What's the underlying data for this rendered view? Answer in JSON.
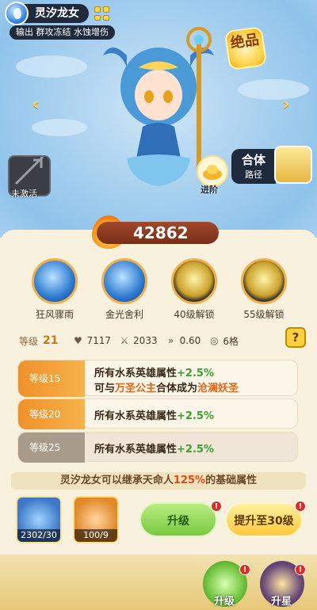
{
  "hero": {
    "name": "灵汐龙女",
    "tags": "输出 群攻冻结 水蚀增伤",
    "rarity": "绝品",
    "weapon_status": "未激活",
    "advance_label": "进阶",
    "merge_title": "合体",
    "merge_sub": "路径"
  },
  "power": "42862",
  "skills": [
    {
      "label": "狂风骤雨",
      "locked": false
    },
    {
      "label": "金光舍利",
      "locked": false
    },
    {
      "label": "40级解锁",
      "locked": true
    },
    {
      "label": "55级解锁",
      "locked": true
    }
  ],
  "stats": {
    "level_label": "等级",
    "level_value": "21",
    "hp": "7117",
    "atk": "2033",
    "speed": "0.60",
    "cells": "6格",
    "help": "?"
  },
  "level_rows": [
    {
      "tag": "等级15",
      "line1_a": "所有水系英雄属性",
      "line1_b": "+2.5%",
      "line2_a": "可与",
      "line2_b": "万圣公主",
      "line2_c": "合体成为",
      "line2_d": "沧澜妖圣",
      "active": true
    },
    {
      "tag": "等级20",
      "line1_a": "所有水系英雄属性",
      "line1_b": "+2.5%",
      "active": true
    },
    {
      "tag": "等级25",
      "line1_a": "所有水系英雄属性",
      "line1_b": "+2.5%",
      "active": false
    }
  ],
  "inherit": {
    "prefix": "灵汐龙女可以继承天命人",
    "pct": "125%",
    "suffix": "的基础属性"
  },
  "materials": [
    {
      "count": "2302/30",
      "color": "#3e78c8"
    },
    {
      "count": "100/9",
      "color": "#e08a2a"
    }
  ],
  "buttons": {
    "upgrade": "升级",
    "promote": "提升至30级",
    "badge": "!"
  },
  "nav": {
    "upgrade": "升级",
    "star": "升星"
  }
}
